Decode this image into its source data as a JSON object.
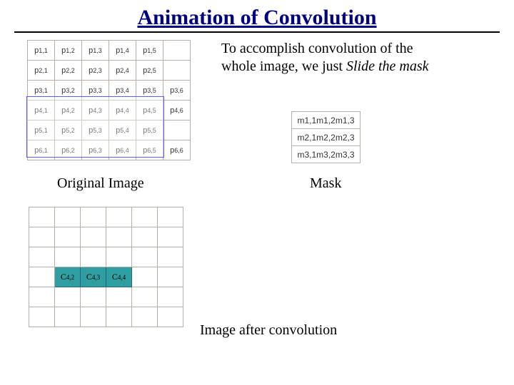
{
  "title": "Animation of Convolution",
  "description": {
    "line1": "To accomplish convolution of the",
    "line2a": "whole image, we just ",
    "line2b": "Slide the mask"
  },
  "p_grid": [
    [
      "p1,1",
      "p1,2",
      "p1,3",
      "p1,4",
      "p1,5",
      ""
    ],
    [
      "p2,1",
      "p2,2",
      "p2,3",
      "p2,4",
      "p2,5",
      ""
    ],
    [
      "p3,1",
      "p3,2",
      "p3,3",
      "p3,4",
      "p3,5",
      "p3,6"
    ],
    [
      "p4,1",
      "p4,2",
      "p4,3",
      "p4,4",
      "p4,5",
      "p4,6"
    ],
    [
      "p5,1",
      "p5,2",
      "p5,3",
      "p5,4",
      "p5,5",
      ""
    ],
    [
      "p6,1",
      "p6,2",
      "p6,3",
      "p6,4",
      "p6,5",
      "p6,6"
    ]
  ],
  "original_label": "Original Image",
  "mask_grid": [
    "m1,1m1,2m1,3",
    "m2,1m2,2m2,3",
    "m3,1m3,2m3,3"
  ],
  "mask_label": "Mask",
  "out_fill": {
    "row": 3,
    "cells": [
      "C4,2",
      "C4,3",
      "C4,4"
    ]
  },
  "out_rows": 6,
  "out_cols": 6,
  "after_label": "Image after convolution"
}
